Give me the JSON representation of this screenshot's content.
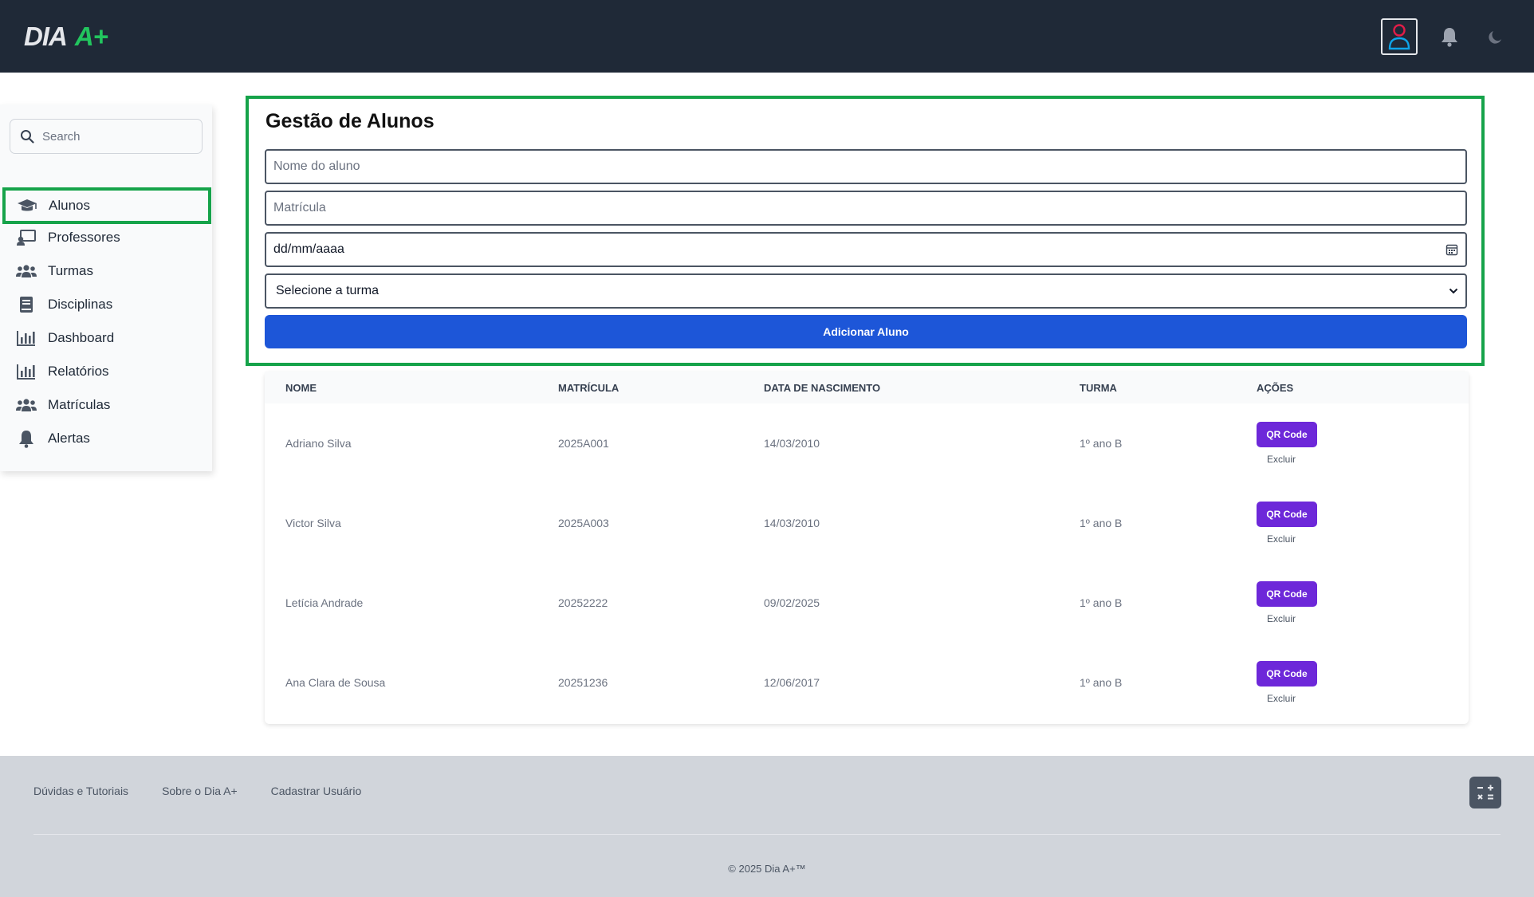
{
  "header": {
    "logo_main": "DIA",
    "logo_plus": "A+",
    "icons": [
      "user-icon",
      "bell-icon",
      "moon-icon"
    ]
  },
  "sidebar": {
    "search_placeholder": "Search",
    "items": [
      {
        "label": "Alunos",
        "icon": "graduation-cap-icon",
        "active": true
      },
      {
        "label": "Professores",
        "icon": "teacher-board-icon"
      },
      {
        "label": "Turmas",
        "icon": "users-group-icon"
      },
      {
        "label": "Disciplinas",
        "icon": "book-icon"
      },
      {
        "label": "Dashboard",
        "icon": "bar-chart-icon"
      },
      {
        "label": "Relatórios",
        "icon": "bar-chart-icon"
      },
      {
        "label": "Matrículas",
        "icon": "users-group-icon"
      },
      {
        "label": "Alertas",
        "icon": "bell-icon"
      }
    ]
  },
  "form": {
    "title": "Gestão de Alunos",
    "name_placeholder": "Nome do aluno",
    "matricula_placeholder": "Matrícula",
    "date_value": "dd/mm/aaaa",
    "turma_selected": "Selecione a turma",
    "add_label": "Adicionar Aluno"
  },
  "table": {
    "headers": [
      "NOME",
      "MATRÍCULA",
      "DATA DE NASCIMENTO",
      "TURMA",
      "AÇÕES"
    ],
    "qr_label": "QR Code",
    "delete_label": "Excluir",
    "rows": [
      {
        "nome": "Adriano Silva",
        "matricula": "2025A001",
        "nascimento": "14/03/2010",
        "turma": "1º ano B"
      },
      {
        "nome": "Victor Silva",
        "matricula": "2025A003",
        "nascimento": "14/03/2010",
        "turma": "1º ano B"
      },
      {
        "nome": "Letícia Andrade",
        "matricula": "20252222",
        "nascimento": "09/02/2025",
        "turma": "1º ano B"
      },
      {
        "nome": "Ana Clara de Sousa",
        "matricula": "20251236",
        "nascimento": "12/06/2017",
        "turma": "1º ano B"
      }
    ]
  },
  "footer": {
    "links": [
      "Dúvidas e Tutoriais",
      "Sobre o Dia A+",
      "Cadastrar Usuário"
    ],
    "copyright": "© 2025 Dia A+™"
  },
  "colors": {
    "topbar": "#1f2937",
    "accent_green": "#16a34a",
    "primary_blue": "#1d56d8",
    "qr_purple": "#6d28d9"
  }
}
